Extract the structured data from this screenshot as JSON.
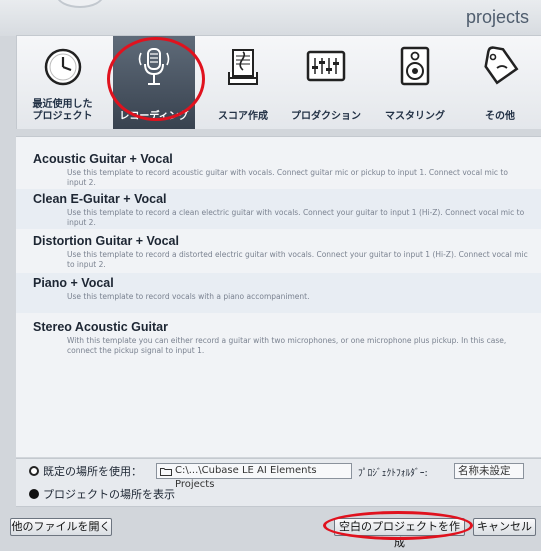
{
  "header": {
    "title": "projects"
  },
  "categories": [
    {
      "icon": "clock-icon",
      "label": "最近使用した\nプロジェクト",
      "selected": false
    },
    {
      "icon": "microphone-icon",
      "label": "レコーディング",
      "selected": true
    },
    {
      "icon": "music-score-icon",
      "label": "スコア作成",
      "selected": false
    },
    {
      "icon": "mixer-icon",
      "label": "プロダクション",
      "selected": false
    },
    {
      "icon": "speaker-icon",
      "label": "マスタリング",
      "selected": false
    },
    {
      "icon": "tag-icon",
      "label": "その他",
      "selected": false
    }
  ],
  "templates": [
    {
      "title": "Acoustic Guitar + Vocal",
      "desc": "Use this template to record acoustic guitar with vocals. Connect guitar mic or pickup to input  1. Connect vocal mic to input 2."
    },
    {
      "title": "Clean E-Guitar + Vocal",
      "desc": "Use this template to record a clean electric guitar with vocals. Connect your guitar to input  1 (Hi-Z). Connect vocal mic to input 2."
    },
    {
      "title": "Distortion Guitar + Vocal",
      "desc": "Use this template to record a distorted electric guitar with vocals. Connect your guitar to input  1 (Hi-Z). Connect vocal mic to input 2."
    },
    {
      "title": "Piano + Vocal",
      "desc": "Use this template to record vocals with a piano accompaniment."
    },
    {
      "title": "Stereo Acoustic Guitar",
      "desc": "With this template you can either record a guitar with two microphones, or one microphone plus pickup. In this case, connect the pickup signal to input 1."
    }
  ],
  "location": {
    "default_label": "既定の場所を使用：",
    "path": "C:\\...\\Cubase LE AI Elements Projects",
    "folder_label": "ﾌﾟﾛｼﾞｪｸﾄﾌｫﾙﾀﾞｰ:",
    "folder_name": "名称未設定",
    "show_label": "プロジェクトの場所を表示"
  },
  "footer": {
    "open_other": "他のファイルを開く",
    "create_empty": "空白のプロジェクトを作成",
    "cancel": "キャンセル"
  }
}
